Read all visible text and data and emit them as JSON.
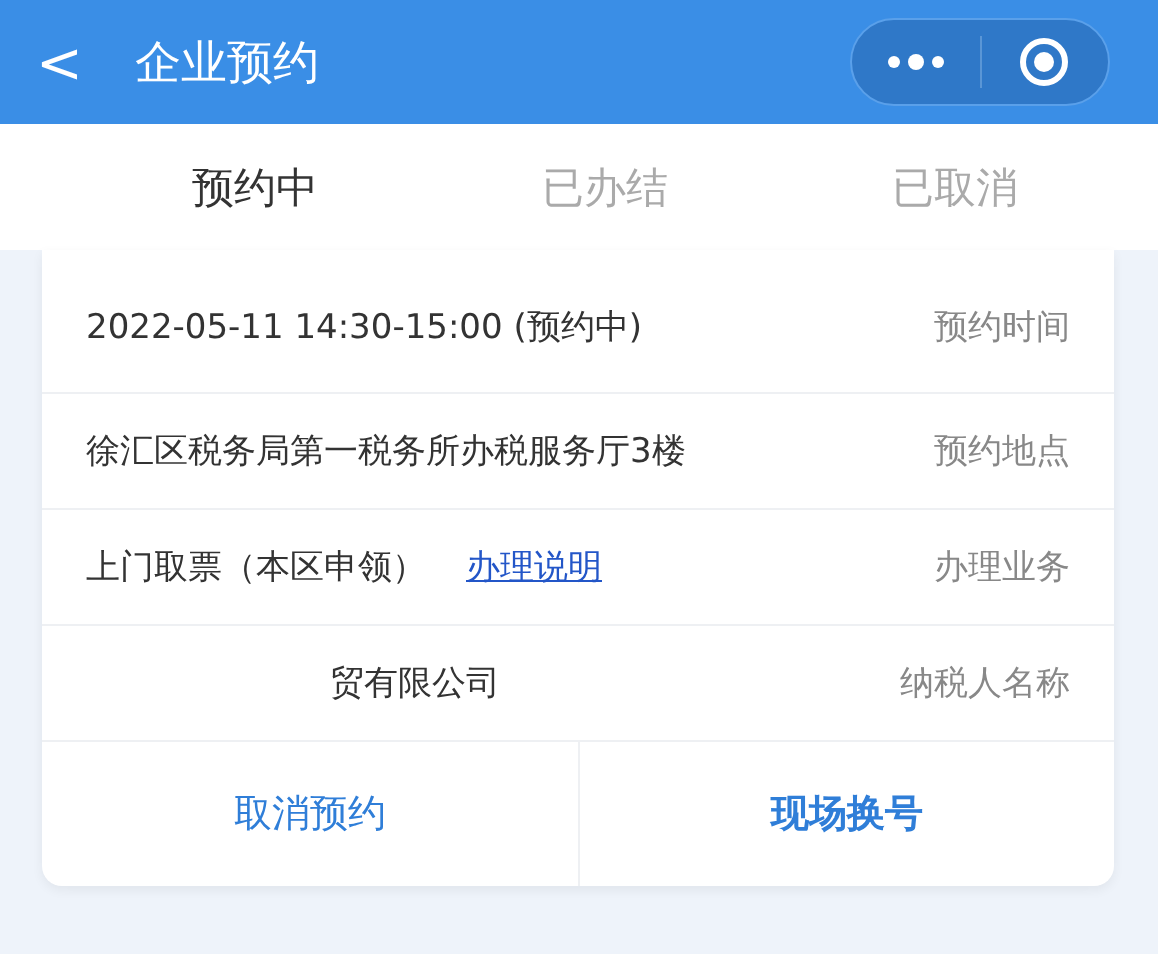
{
  "header": {
    "back": "<",
    "title": "企业预约"
  },
  "tabs": [
    {
      "label": "预约中",
      "selected": true
    },
    {
      "label": "已办结",
      "selected": false
    },
    {
      "label": "已取消",
      "selected": false
    }
  ],
  "rows": [
    {
      "value": "2022-05-11  14:30-15:00 (预约中)",
      "label": "预约时间"
    },
    {
      "value": "徐汇区税务局第一税务所办税服务厅3楼",
      "label": "预约地点"
    },
    {
      "value": "上门取票（本区申领）",
      "link": "办理说明",
      "label": "办理业务"
    },
    {
      "value": "贸有限公司",
      "kind": "redacted",
      "label": "纳税人名称"
    }
  ],
  "actions": [
    "取消预约",
    "现场换号"
  ]
}
